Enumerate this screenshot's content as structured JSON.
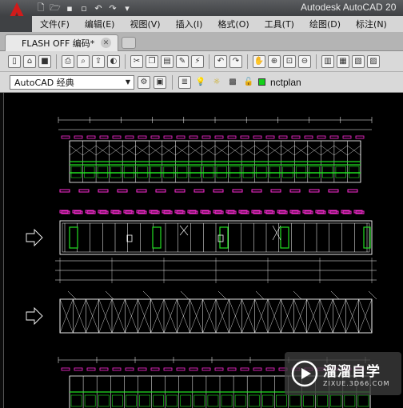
{
  "window": {
    "title": "Autodesk AutoCAD 20"
  },
  "quick_access": {
    "items": [
      "new-icon",
      "open-icon",
      "save-icon",
      "save-as-icon",
      "undo-icon",
      "redo-icon",
      "customize-icon"
    ]
  },
  "menu": {
    "items": [
      "文件(F)",
      "编辑(E)",
      "视图(V)",
      "插入(I)",
      "格式(O)",
      "工具(T)",
      "绘图(D)",
      "标注(N)"
    ]
  },
  "tabs": {
    "active_label": "FLASH OFF 编码*"
  },
  "toolbar": {
    "workspace": "AutoCAD 经典",
    "layer_name": "nctplan",
    "layer_color": "#14d11b"
  },
  "drawing": {
    "colors": {
      "background": "#000000",
      "outline": "#ffffff",
      "magenta": "#ff2bd6",
      "green": "#21e021",
      "cyan": "#00e0e0"
    }
  },
  "watermark": {
    "title": "溜溜自学",
    "subtitle": "ZIXUE.3D66.COM"
  }
}
